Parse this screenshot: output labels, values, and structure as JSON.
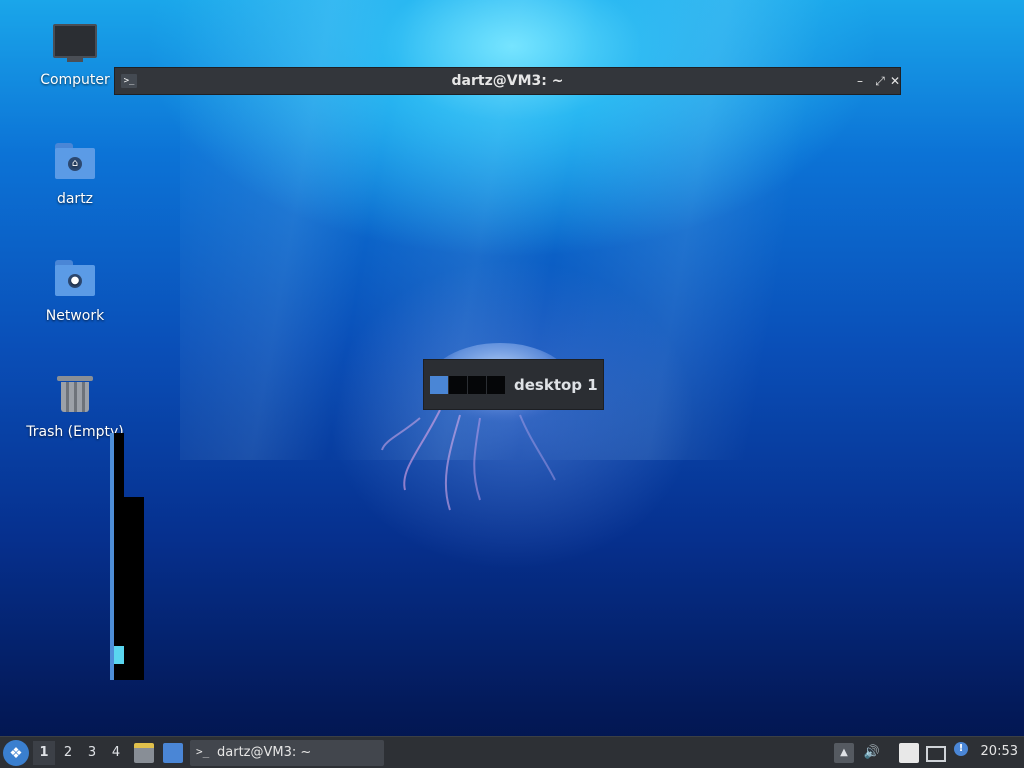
{
  "desktop": {
    "icons": [
      {
        "label": "Computer"
      },
      {
        "label": "dartz"
      },
      {
        "label": "Network"
      },
      {
        "label": "Trash (Empty)"
      }
    ]
  },
  "terminal_window": {
    "title": "dartz@VM3: ~",
    "icon_glyph": ">_",
    "minimize_glyph": "–",
    "maximize_glyph": "⤢",
    "close_glyph": "✕"
  },
  "workspace_osd": {
    "label": "desktop 1",
    "workspace_count": 4,
    "active_index": 0
  },
  "taskbar": {
    "start_glyph": "❖",
    "workspaces": [
      "1",
      "2",
      "3",
      "4"
    ],
    "active_workspace": "1",
    "task": {
      "label": "dartz@VM3: ~",
      "icon_glyph": ">_"
    },
    "tray": {
      "up_arrow_glyph": "▲",
      "volume_glyph": "🔊",
      "clipboard_glyph": "📋",
      "network_glyph": "🖧",
      "update_glyph": "!"
    },
    "clock": "20:53"
  }
}
